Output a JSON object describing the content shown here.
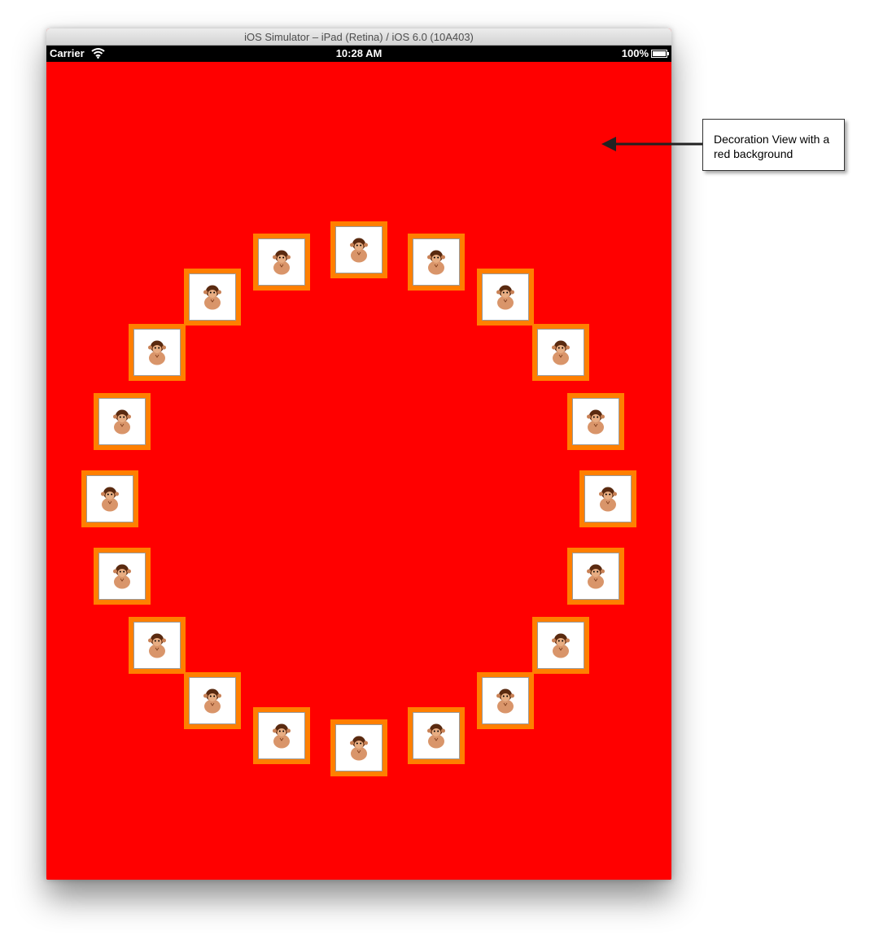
{
  "window": {
    "title": "iOS Simulator – iPad (Retina) / iOS 6.0 (10A403)"
  },
  "status_bar": {
    "carrier": "Carrier",
    "time": "10:28 AM",
    "battery": "100%"
  },
  "decoration_view": {
    "background_color": "#ff0000"
  },
  "cells": {
    "count": 20,
    "border_color": "#ff7f00",
    "icon": "monkey-icon"
  },
  "callout": {
    "text_line1": "Decoration View with a",
    "text_line2": "red background"
  }
}
